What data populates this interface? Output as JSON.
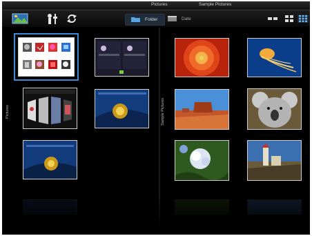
{
  "top_strip": {
    "label_left": "Pictures",
    "label_right": "Sample Pictures"
  },
  "toolbar": {
    "icons": [
      "photo-app-icon",
      "settings-icon",
      "refresh-icon"
    ],
    "tabs": [
      {
        "label": "Folder",
        "active": true
      },
      {
        "label": "Date",
        "active": false
      }
    ],
    "view_modes": [
      "list-view-icon",
      "medium-grid-icon",
      "small-grid-icon"
    ]
  },
  "left_panel": {
    "side_label": "Pictures"
  },
  "right_panel": {
    "side_label": "Sample Pictures"
  },
  "colors": {
    "accent": "#3b8ad6",
    "background": "#000000",
    "border": "#cfcfcf"
  }
}
